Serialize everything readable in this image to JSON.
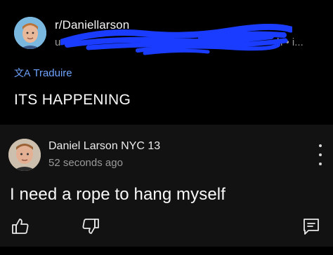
{
  "post": {
    "subreddit": "r/Daniellarson",
    "meta_user_fragment": "u",
    "meta_time_fragment": "h • i...",
    "translate_label": "Traduire",
    "title": "ITS HAPPENING"
  },
  "comment": {
    "author": "Daniel Larson NYC 13",
    "timestamp": "52 seconds ago",
    "text": "I need a rope to hang myself"
  },
  "icons": {
    "translate": "translate-icon",
    "more": "more-vertical-icon",
    "upvote": "thumbs-up-icon",
    "downvote": "thumbs-down-icon",
    "reply": "reply-icon"
  },
  "colors": {
    "background": "#000000",
    "comment_background": "#121212",
    "accent_link": "#6fa3ff",
    "redaction_scribble": "#1a3cff"
  }
}
